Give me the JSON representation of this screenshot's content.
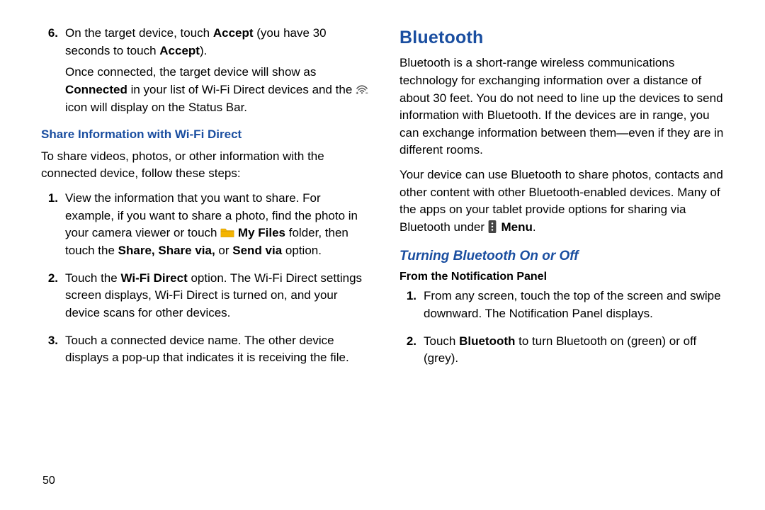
{
  "left": {
    "step6": {
      "num": "6.",
      "text_a": "On the target device, touch ",
      "accept1": "Accept",
      "text_b": " (you have 30 seconds to touch ",
      "accept2": "Accept",
      "text_c": ")."
    },
    "connected_para": {
      "a": "Once connected, the target device will show as ",
      "b": "Connected",
      "c": " in your list of Wi-Fi Direct devices and the ",
      "d": " icon will display on the Status Bar."
    },
    "share_heading": "Share Information with Wi-Fi Direct",
    "share_intro": "To share videos, photos, or other information with the connected device, follow these steps:",
    "step1": {
      "num": "1.",
      "a": "View the information that you want to share. For example, if you want to share a photo, find the photo in your camera viewer or touch ",
      "myfiles": " My Files",
      "b": " folder, then touch the ",
      "share": "Share, Share via,",
      "c": " or ",
      "sendvia": "Send via",
      "d": " option."
    },
    "step2": {
      "num": "2.",
      "a": "Touch the ",
      "wfd": "Wi-Fi Direct",
      "b": " option. The Wi-Fi Direct settings screen displays, Wi-Fi Direct is turned on, and your device scans for other devices."
    },
    "step3": {
      "num": "3.",
      "text": "Touch a connected device name. The other device displays a pop-up that indicates it is receiving the file."
    }
  },
  "right": {
    "title": "Bluetooth",
    "p1": "Bluetooth is a short-range wireless communications technology for exchanging information over a distance of about 30 feet. You do not need to line up the devices to send information with Bluetooth. If the devices are in range, you can exchange information between them—even if they are in different rooms.",
    "p2a": "Your device can use Bluetooth to share photos, contacts and other content with other Bluetooth-enabled devices. Many of the apps on your tablet provide options for sharing via Bluetooth under ",
    "p2menu": " Menu",
    "p2b": ".",
    "subheading": "Turning Bluetooth On or Off",
    "panel_heading": "From the Notification Panel",
    "r1": {
      "num": "1.",
      "text": "From any screen, touch the top of the screen and swipe downward. The Notification Panel displays."
    },
    "r2": {
      "num": "2.",
      "a": "Touch ",
      "bt": "Bluetooth",
      "b": " to turn Bluetooth on (green) or off (grey)."
    }
  },
  "pagenum": "50"
}
